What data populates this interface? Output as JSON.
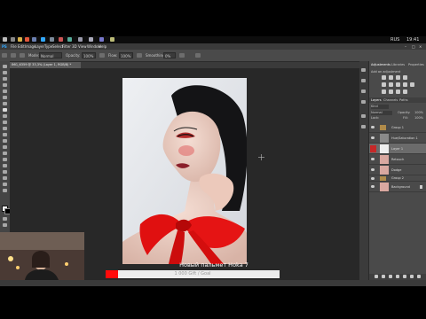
{
  "taskbar": {
    "clock": "19:41",
    "lang": "RUS",
    "icons": [
      "windows-start-icon",
      "search-icon",
      "explorer-icon",
      "chrome-icon",
      "app-icon",
      "photoshop-icon",
      "app-icon",
      "app-icon",
      "app-icon",
      "app-icon",
      "app-icon",
      "app-icon",
      "app-icon"
    ]
  },
  "menubar": {
    "items": [
      "PS",
      "File",
      "Edit",
      "Image",
      "Layer",
      "Type",
      "Select",
      "Filter",
      "3D",
      "View",
      "Window",
      "Help"
    ]
  },
  "options": {
    "mode_label": "Mode:",
    "mode_value": "Normal",
    "opacity_label": "Opacity:",
    "opacity_value": "100%",
    "flow_label": "Flow:",
    "flow_value": "100%",
    "smoothing_label": "Smoothing:",
    "smoothing_value": "0%"
  },
  "document_tab": {
    "title": "IMG_6359 @ 33,3% (Layer 1, RGB/8) *"
  },
  "panel": {
    "tabs": [
      "Adjustments",
      "Libraries",
      "Properties"
    ],
    "adjustments_title": "Add an adjustment",
    "layers_tabs": [
      "Layers",
      "Channels",
      "Paths"
    ],
    "blend_mode": "Normal",
    "opacity_label": "Opacity:",
    "opacity_value": "100%",
    "lock_label": "Lock:",
    "fill_label": "Fill:",
    "fill_value": "100%",
    "layers": [
      {
        "name": "Group 1"
      },
      {
        "name": "Hue/Saturation 1"
      },
      {
        "name": "Layer 1"
      },
      {
        "name": "Retouch"
      },
      {
        "name": "Dodge"
      },
      {
        "name": "Group 2"
      },
      {
        "name": "Background"
      }
    ]
  },
  "video_overlay": {
    "caption": "Новый пальмет Hoka 7",
    "progress_text": "1 000 Gift / Goal",
    "progress_fraction": 0.07
  },
  "colors": {
    "accent_red": "#ff0a0a",
    "panel_bg": "#4a4a4a",
    "canvas_bg": "#282828"
  }
}
